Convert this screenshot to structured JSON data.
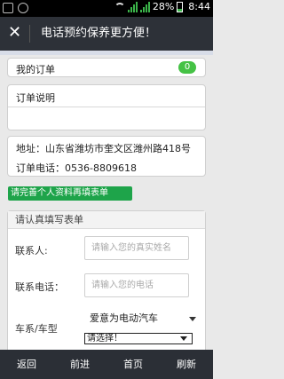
{
  "status_bar": {
    "battery": "28%",
    "time": "8:44"
  },
  "title_bar": {
    "close_glyph": "✕",
    "title": "电话预约保养更方便！"
  },
  "orders": {
    "label": "我的订单",
    "count": "0"
  },
  "order_note": {
    "label": "订单说明"
  },
  "shop": {
    "address_label": "地址：",
    "address": "山东省潍坊市奎文区潍州路418号",
    "phone_label": "订单电话：",
    "phone": "0536-8809618"
  },
  "notice": "请完善个人资料再填表单",
  "form": {
    "heading": "请认真填写表单",
    "contact_label": "联系人:",
    "contact_placeholder": "请输入您的真实姓名",
    "phone_label": "联系电话：",
    "phone_placeholder": "请输入您的电话",
    "model_label": "车系/车型",
    "series_value": "爱意为电动汽车",
    "model_value": "请选择！"
  },
  "bottom_nav": {
    "back": "返回",
    "forward": "前进",
    "home": "首页",
    "refresh": "刷新"
  },
  "colors": {
    "title_bar": "#2d3138",
    "bottom_bar": "#2b2f36",
    "badge": "#45c245",
    "notice": "#1ea44a"
  }
}
